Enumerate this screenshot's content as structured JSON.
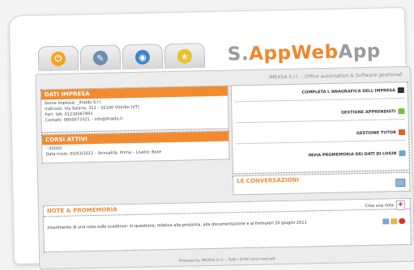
{
  "app": {
    "logo_s": "S.",
    "logo_appweb": "AppWeb",
    "logo_app": "App",
    "tagline": "iMEXSA S.r.l. – Office automation & Software gestionali"
  },
  "tabs": [
    {
      "icon": "home-icon",
      "color": "#f7a21b",
      "glyph": "⏻"
    },
    {
      "icon": "edit-icon",
      "color": "#6c8fb0",
      "glyph": "✎"
    },
    {
      "icon": "globe-icon",
      "color": "#3a86c8",
      "glyph": "◉"
    },
    {
      "icon": "star-icon",
      "color": "#e8c32a",
      "glyph": "★"
    }
  ],
  "company": {
    "title": "DATI IMPRESA",
    "lines": [
      "Nome Impresa: _Ifraldo S.r.l.",
      "Indirizzo: Via Salaria, 312 – 02100 Viterbo (VT)",
      "Part. IVA: 01234567891",
      "Contatti: 0650573321 – info@ifraldo.it"
    ]
  },
  "courses": {
    "title": "CORSI ATTIVI",
    "lines": [
      "– 00000",
      "Data Inizio: 05/03/2013 – Annualità: Prima – Livello: Base"
    ]
  },
  "actions": [
    {
      "label": "COMPLETA L'ANAGRAFICA DELL'IMPRESA",
      "icon": "card-icon",
      "color": "#333333"
    },
    {
      "label": "GESTIONE APPRENDISTI",
      "icon": "people-icon",
      "color": "#7bbf3a"
    },
    {
      "label": "GESTIONE TUTOR",
      "icon": "lifebuoy-icon",
      "color": "#e0602a"
    },
    {
      "label": "INVIA PROMEMORIA DEI DATI DI LOGIN",
      "icon": "mail-icon",
      "color": "#6aa4d8"
    }
  ],
  "conversations": {
    "title": "LE CONVERSAZIONI"
  },
  "notes": {
    "title": "NOTE & PROMEMORIA",
    "create_label": "Crea una nota",
    "text": "Inserimento di una nota sulle scadenze: in questione, relativa alla prossima, alla documentazione e ai formulari 20 giugno 2011"
  },
  "footer": {
    "text": "Powered by iMEXSA S.r.l. – Tutti i diritti sono riservati"
  }
}
